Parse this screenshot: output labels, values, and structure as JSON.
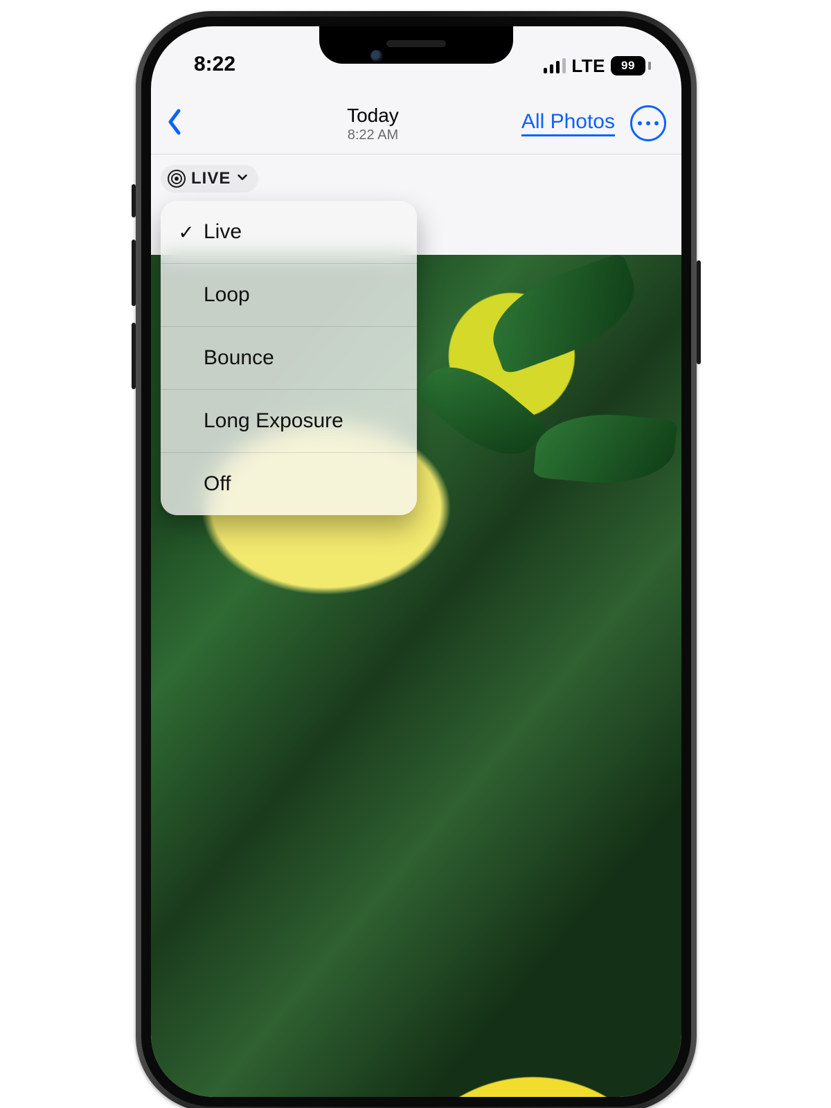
{
  "status": {
    "time": "8:22",
    "network_label": "LTE",
    "battery_percent": "99"
  },
  "nav": {
    "title": "Today",
    "subtitle": "8:22 AM",
    "all_photos_label": "All Photos"
  },
  "live_badge": {
    "label": "LIVE"
  },
  "menu": {
    "items": [
      {
        "label": "Live",
        "checked": true
      },
      {
        "label": "Loop",
        "checked": false
      },
      {
        "label": "Bounce",
        "checked": false
      },
      {
        "label": "Long Exposure",
        "checked": false
      },
      {
        "label": "Off",
        "checked": false
      }
    ]
  },
  "colors": {
    "accent": "#0a62ff"
  }
}
